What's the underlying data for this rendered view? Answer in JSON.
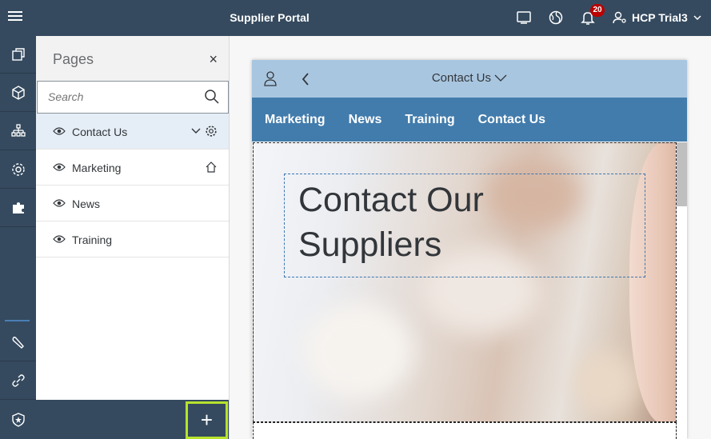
{
  "shell": {
    "title": "Supplier Portal",
    "notification_count": "20",
    "user_name": "HCP Trial3",
    "icons": [
      "menu-icon",
      "screen-icon",
      "globe-icon",
      "bell-icon",
      "user-settings-icon",
      "chevron-down-icon"
    ]
  },
  "left_nav": {
    "items": [
      "site-pages-icon",
      "cube-icon",
      "sitemap-icon",
      "settings-icon",
      "puzzle-icon",
      "wrench-icon",
      "link-icon",
      "shield-icon"
    ]
  },
  "pages_panel": {
    "title": "Pages",
    "close_symbol": "×",
    "search": {
      "placeholder": "Search",
      "value": ""
    },
    "items": [
      {
        "label": "Contact Us",
        "selected": true,
        "icons": [
          "eye-icon",
          "chevron-down-icon",
          "gear-icon"
        ]
      },
      {
        "label": "Marketing",
        "selected": false,
        "icons": [
          "eye-icon",
          "home-icon"
        ]
      },
      {
        "label": "News",
        "selected": false,
        "icons": [
          "eye-icon"
        ]
      },
      {
        "label": "Training",
        "selected": false,
        "icons": [
          "eye-icon"
        ]
      }
    ],
    "add_symbol": "+"
  },
  "preview": {
    "page_title": "Contact Us",
    "nav": [
      "Marketing",
      "News",
      "Training",
      "Contact Us"
    ],
    "hero_line1": "Contact Our",
    "hero_line2": "Suppliers"
  },
  "colors": {
    "shell": "#354a5f",
    "preview_header": "#a9c6e0",
    "preview_nav": "#427cac",
    "add_button_highlight": "#b7e32d",
    "badge": "#bb0000"
  }
}
